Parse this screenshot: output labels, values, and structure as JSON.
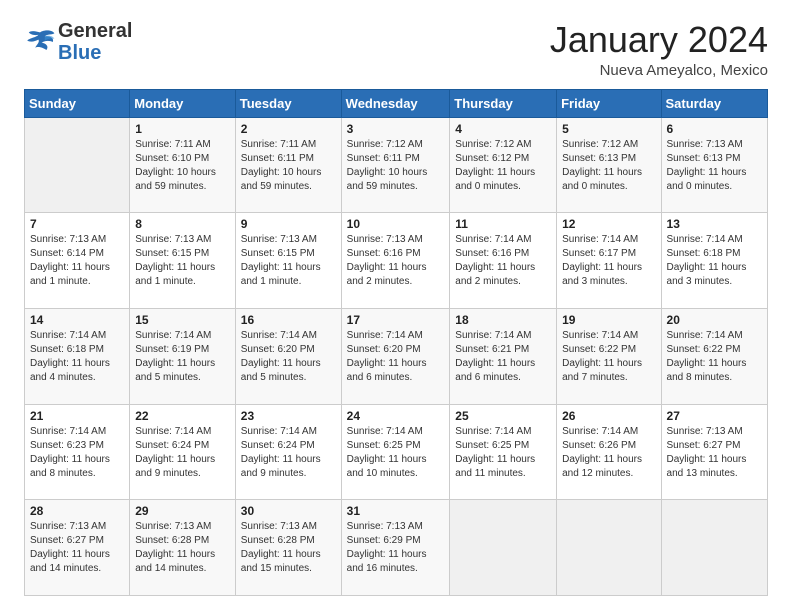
{
  "header": {
    "logo": {
      "general": "General",
      "blue": "Blue"
    },
    "title": "January 2024",
    "location": "Nueva Ameyalco, Mexico"
  },
  "weekdays": [
    "Sunday",
    "Monday",
    "Tuesday",
    "Wednesday",
    "Thursday",
    "Friday",
    "Saturday"
  ],
  "weeks": [
    [
      {
        "day": "",
        "sunrise": "",
        "sunset": "",
        "daylight": ""
      },
      {
        "day": "1",
        "sunrise": "Sunrise: 7:11 AM",
        "sunset": "Sunset: 6:10 PM",
        "daylight": "Daylight: 10 hours and 59 minutes."
      },
      {
        "day": "2",
        "sunrise": "Sunrise: 7:11 AM",
        "sunset": "Sunset: 6:11 PM",
        "daylight": "Daylight: 10 hours and 59 minutes."
      },
      {
        "day": "3",
        "sunrise": "Sunrise: 7:12 AM",
        "sunset": "Sunset: 6:11 PM",
        "daylight": "Daylight: 10 hours and 59 minutes."
      },
      {
        "day": "4",
        "sunrise": "Sunrise: 7:12 AM",
        "sunset": "Sunset: 6:12 PM",
        "daylight": "Daylight: 11 hours and 0 minutes."
      },
      {
        "day": "5",
        "sunrise": "Sunrise: 7:12 AM",
        "sunset": "Sunset: 6:13 PM",
        "daylight": "Daylight: 11 hours and 0 minutes."
      },
      {
        "day": "6",
        "sunrise": "Sunrise: 7:13 AM",
        "sunset": "Sunset: 6:13 PM",
        "daylight": "Daylight: 11 hours and 0 minutes."
      }
    ],
    [
      {
        "day": "7",
        "sunrise": "Sunrise: 7:13 AM",
        "sunset": "Sunset: 6:14 PM",
        "daylight": "Daylight: 11 hours and 1 minute."
      },
      {
        "day": "8",
        "sunrise": "Sunrise: 7:13 AM",
        "sunset": "Sunset: 6:15 PM",
        "daylight": "Daylight: 11 hours and 1 minute."
      },
      {
        "day": "9",
        "sunrise": "Sunrise: 7:13 AM",
        "sunset": "Sunset: 6:15 PM",
        "daylight": "Daylight: 11 hours and 1 minute."
      },
      {
        "day": "10",
        "sunrise": "Sunrise: 7:13 AM",
        "sunset": "Sunset: 6:16 PM",
        "daylight": "Daylight: 11 hours and 2 minutes."
      },
      {
        "day": "11",
        "sunrise": "Sunrise: 7:14 AM",
        "sunset": "Sunset: 6:16 PM",
        "daylight": "Daylight: 11 hours and 2 minutes."
      },
      {
        "day": "12",
        "sunrise": "Sunrise: 7:14 AM",
        "sunset": "Sunset: 6:17 PM",
        "daylight": "Daylight: 11 hours and 3 minutes."
      },
      {
        "day": "13",
        "sunrise": "Sunrise: 7:14 AM",
        "sunset": "Sunset: 6:18 PM",
        "daylight": "Daylight: 11 hours and 3 minutes."
      }
    ],
    [
      {
        "day": "14",
        "sunrise": "Sunrise: 7:14 AM",
        "sunset": "Sunset: 6:18 PM",
        "daylight": "Daylight: 11 hours and 4 minutes."
      },
      {
        "day": "15",
        "sunrise": "Sunrise: 7:14 AM",
        "sunset": "Sunset: 6:19 PM",
        "daylight": "Daylight: 11 hours and 5 minutes."
      },
      {
        "day": "16",
        "sunrise": "Sunrise: 7:14 AM",
        "sunset": "Sunset: 6:20 PM",
        "daylight": "Daylight: 11 hours and 5 minutes."
      },
      {
        "day": "17",
        "sunrise": "Sunrise: 7:14 AM",
        "sunset": "Sunset: 6:20 PM",
        "daylight": "Daylight: 11 hours and 6 minutes."
      },
      {
        "day": "18",
        "sunrise": "Sunrise: 7:14 AM",
        "sunset": "Sunset: 6:21 PM",
        "daylight": "Daylight: 11 hours and 6 minutes."
      },
      {
        "day": "19",
        "sunrise": "Sunrise: 7:14 AM",
        "sunset": "Sunset: 6:22 PM",
        "daylight": "Daylight: 11 hours and 7 minutes."
      },
      {
        "day": "20",
        "sunrise": "Sunrise: 7:14 AM",
        "sunset": "Sunset: 6:22 PM",
        "daylight": "Daylight: 11 hours and 8 minutes."
      }
    ],
    [
      {
        "day": "21",
        "sunrise": "Sunrise: 7:14 AM",
        "sunset": "Sunset: 6:23 PM",
        "daylight": "Daylight: 11 hours and 8 minutes."
      },
      {
        "day": "22",
        "sunrise": "Sunrise: 7:14 AM",
        "sunset": "Sunset: 6:24 PM",
        "daylight": "Daylight: 11 hours and 9 minutes."
      },
      {
        "day": "23",
        "sunrise": "Sunrise: 7:14 AM",
        "sunset": "Sunset: 6:24 PM",
        "daylight": "Daylight: 11 hours and 9 minutes."
      },
      {
        "day": "24",
        "sunrise": "Sunrise: 7:14 AM",
        "sunset": "Sunset: 6:25 PM",
        "daylight": "Daylight: 11 hours and 10 minutes."
      },
      {
        "day": "25",
        "sunrise": "Sunrise: 7:14 AM",
        "sunset": "Sunset: 6:25 PM",
        "daylight": "Daylight: 11 hours and 11 minutes."
      },
      {
        "day": "26",
        "sunrise": "Sunrise: 7:14 AM",
        "sunset": "Sunset: 6:26 PM",
        "daylight": "Daylight: 11 hours and 12 minutes."
      },
      {
        "day": "27",
        "sunrise": "Sunrise: 7:13 AM",
        "sunset": "Sunset: 6:27 PM",
        "daylight": "Daylight: 11 hours and 13 minutes."
      }
    ],
    [
      {
        "day": "28",
        "sunrise": "Sunrise: 7:13 AM",
        "sunset": "Sunset: 6:27 PM",
        "daylight": "Daylight: 11 hours and 14 minutes."
      },
      {
        "day": "29",
        "sunrise": "Sunrise: 7:13 AM",
        "sunset": "Sunset: 6:28 PM",
        "daylight": "Daylight: 11 hours and 14 minutes."
      },
      {
        "day": "30",
        "sunrise": "Sunrise: 7:13 AM",
        "sunset": "Sunset: 6:28 PM",
        "daylight": "Daylight: 11 hours and 15 minutes."
      },
      {
        "day": "31",
        "sunrise": "Sunrise: 7:13 AM",
        "sunset": "Sunset: 6:29 PM",
        "daylight": "Daylight: 11 hours and 16 minutes."
      },
      {
        "day": "",
        "sunrise": "",
        "sunset": "",
        "daylight": ""
      },
      {
        "day": "",
        "sunrise": "",
        "sunset": "",
        "daylight": ""
      },
      {
        "day": "",
        "sunrise": "",
        "sunset": "",
        "daylight": ""
      }
    ]
  ]
}
